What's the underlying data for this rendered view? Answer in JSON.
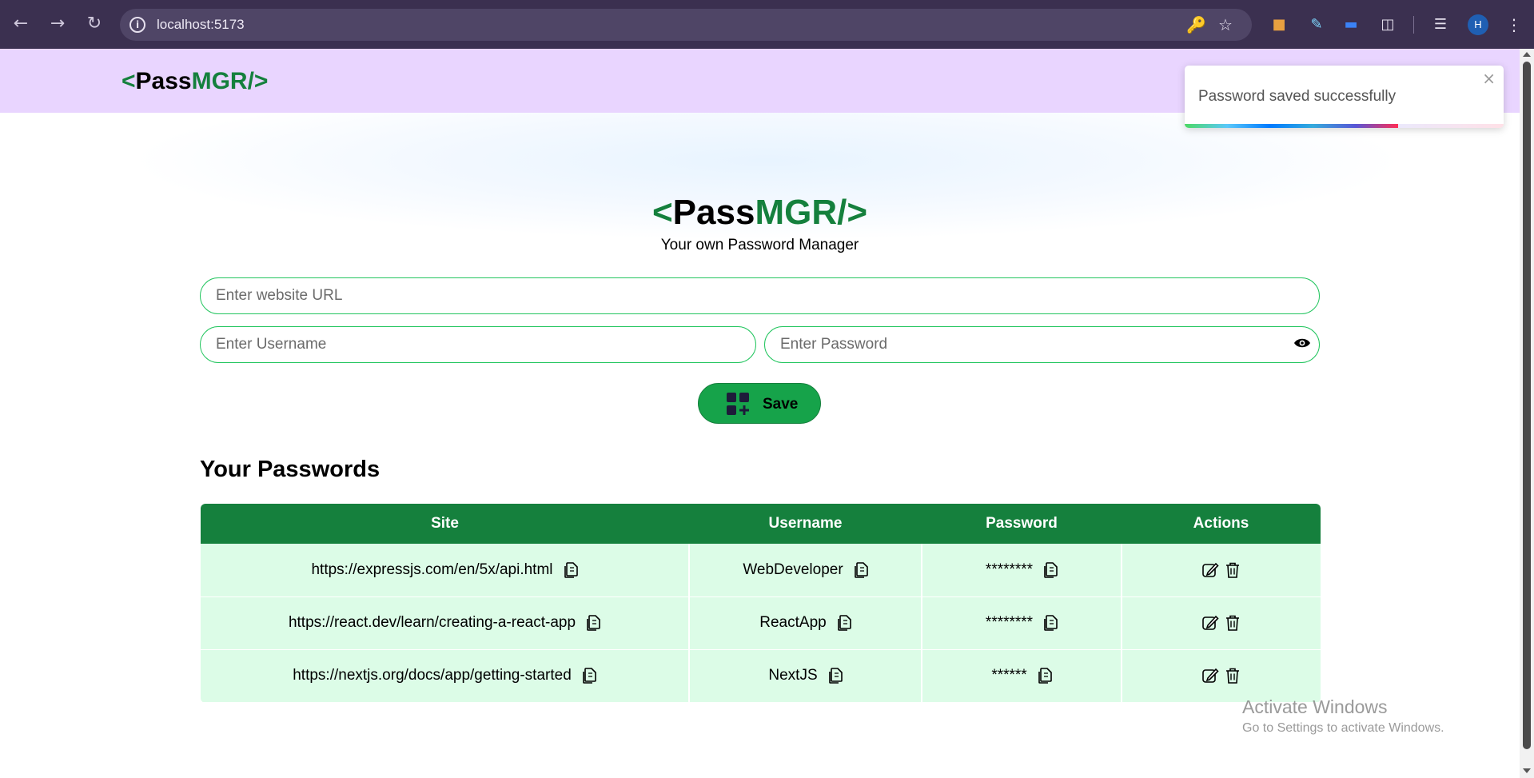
{
  "browser": {
    "url": "localhost:5173",
    "profile_initial": "H"
  },
  "navbar": {
    "logo_open": "<",
    "logo_pass": "Pass",
    "logo_mgr": "MGR/>",
    "logo_close": ""
  },
  "hero": {
    "logo_open": "<",
    "logo_pass": "Pass",
    "logo_mgr": "MGR/>",
    "subtitle": "Your own Password Manager"
  },
  "form": {
    "url_placeholder": "Enter website URL",
    "username_placeholder": "Enter Username",
    "password_placeholder": "Enter Password",
    "save_label": "Save"
  },
  "passwords": {
    "heading": "Your Passwords",
    "columns": [
      "Site",
      "Username",
      "Password",
      "Actions"
    ],
    "rows": [
      {
        "site": "https://expressjs.com/en/5x/api.html",
        "username": "WebDeveloper",
        "password": "********"
      },
      {
        "site": "https://react.dev/learn/creating-a-react-app",
        "username": "ReactApp",
        "password": "********"
      },
      {
        "site": "https://nextjs.org/docs/app/getting-started",
        "username": "NextJS",
        "password": "******"
      }
    ]
  },
  "toast": {
    "message": "Password saved successfully",
    "close": "×",
    "progress": 0.67
  },
  "watermark": {
    "line1": "Activate Windows",
    "line2": "Go to Settings to activate Windows."
  },
  "colors": {
    "brand_green": "#15803d",
    "button_green": "#16a34a",
    "navbar_bg": "#e9d5ff",
    "row_bg": "#dcfce7"
  }
}
